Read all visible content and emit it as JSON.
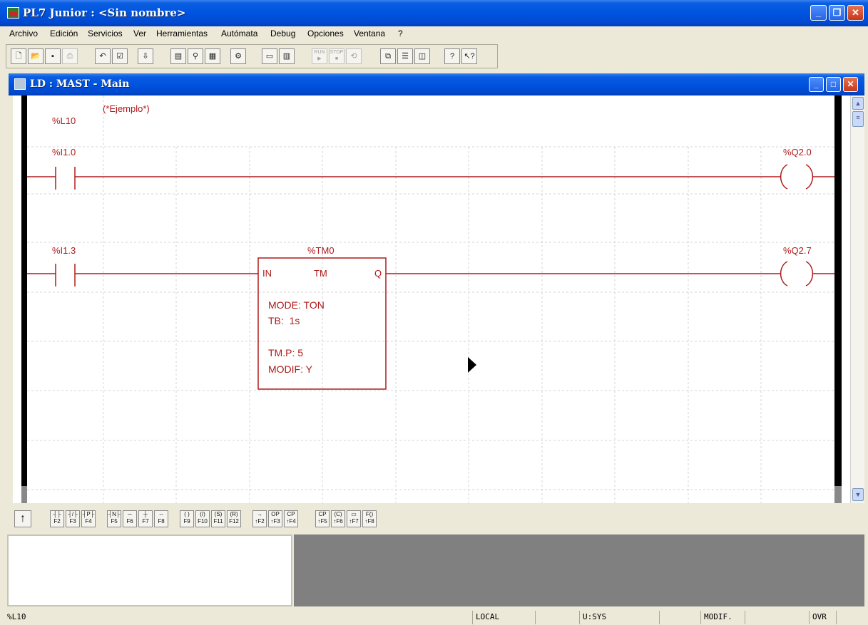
{
  "app": {
    "title": "PL7 Junior : <Sin nombre>"
  },
  "menu": [
    "Archivo",
    "Edición",
    "Servicios",
    "Ver",
    "Herramientas",
    "Autómata",
    "Debug",
    "Opciones",
    "Ventana",
    "?"
  ],
  "toolbar": {
    "icons": [
      "new-icon",
      "open-icon",
      "save-icon",
      "print-icon",
      "undo-icon",
      "validate-icon",
      "transfer-icon",
      "variables-icon",
      "find-icon",
      "cross-ref-icon",
      "config-icon",
      "connect-icon",
      "animation-icon",
      "run-icon",
      "stop-icon",
      "init-icon",
      "cascade-icon",
      "tile-h-icon",
      "tile-v-icon",
      "help-icon",
      "context-help-icon"
    ],
    "run_label": "RUN",
    "stop_label": "STOP"
  },
  "child_window": {
    "title": "LD : MAST - Main"
  },
  "ladder": {
    "label": "%L10",
    "comment": "(*Ejemplo*)",
    "rungs": [
      {
        "contact": "%I1.0",
        "coil": "%Q2.0"
      },
      {
        "contact": "%I1.3",
        "coil": "%Q2.7"
      }
    ],
    "timer": {
      "name": "%TM0",
      "in": "IN",
      "type": "TM",
      "out": "Q",
      "mode": "MODE: TON",
      "tb": "TB:  1s",
      "preset": "TM.P: 5",
      "modif": "MODIF: Y"
    }
  },
  "fbar": {
    "arrow": "↑",
    "keys": [
      "F2",
      "F3",
      "F4",
      "F5",
      "F6",
      "F7",
      "F8",
      "F9",
      "F10",
      "F11",
      "F12",
      "↑F2",
      "↑F3",
      "↑F4",
      "↑F5",
      "↑F6",
      "↑F7",
      "↑F8"
    ]
  },
  "status": {
    "cursor": "%L10",
    "mode": "LOCAL",
    "user": "U:SYS",
    "state": "MODIF.",
    "insert": "OVR"
  }
}
